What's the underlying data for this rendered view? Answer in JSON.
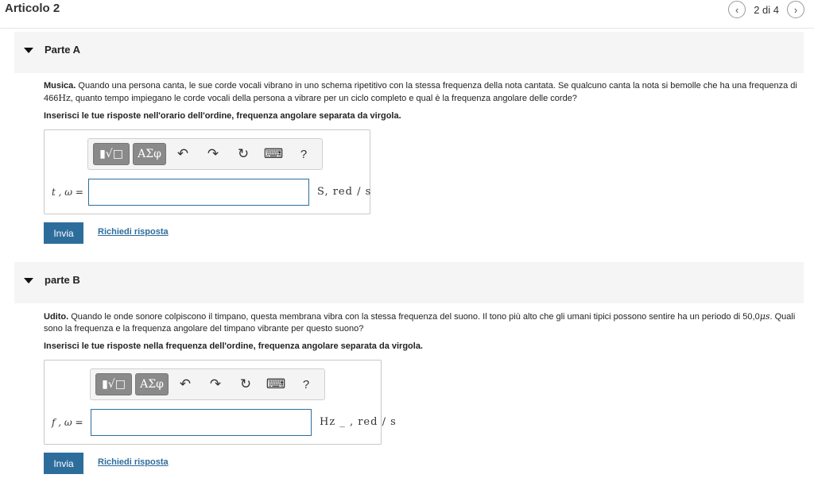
{
  "header": {
    "title": "Articolo 2",
    "prev_icon": "chevron-left-icon",
    "next_icon": "chevron-right-icon",
    "pager_text": "2 di 4"
  },
  "part_a": {
    "title": "Parte A",
    "question_lead": "Musica.",
    "question_text_1": " Quando una persona canta, le sue corde vocali vibrano in uno schema ripetitivo con la stessa frequenza della nota cantata. Se qualcuno canta la nota si bemolle che ha una frequenza di 466",
    "question_unit": "Hz",
    "question_text_2": ", quanto tempo impiegano le corde vocali della persona a vibrare per un ciclo completo e qual è la frequenza angolare delle corde?",
    "instruction": "Inserisci le tue risposte nell'orario dell'ordine, frequenza angolare separata da virgola.",
    "equation_label": "t , ω =",
    "input_value": "",
    "unit_label": "S, red / s",
    "submit_label": "Invia",
    "request_label": "Richiedi risposta"
  },
  "part_b": {
    "title": "parte B",
    "question_lead": "Udito.",
    "question_text_1": " Quando le onde sonore colpiscono il timpano, questa membrana vibra con la stessa frequenza del suono. Il tono più alto che gli umani tipici possono sentire ha un periodo di 50,0",
    "question_unit": "μs",
    "question_text_2": ". Quali sono la frequenza e la frequenza angolare del timpano vibrante per questo suono?",
    "instruction": "Inserisci le tue risposte nella frequenza dell'ordine, frequenza angolare separata da virgola.",
    "equation_label": "f , ω =",
    "input_value": "",
    "unit_label": "Hz _ , red / s",
    "submit_label": "Invia",
    "request_label": "Richiedi risposta"
  },
  "toolbar": {
    "template_icon": "template-icon",
    "greek_label": "ΑΣφ",
    "undo_icon": "undo-icon",
    "redo_icon": "redo-icon",
    "reset_icon": "reset-icon",
    "keyboard_icon": "keyboard-icon",
    "help_label": "?"
  },
  "colors": {
    "accent": "#2d6d9c",
    "header_bg": "#f5f5f5"
  }
}
